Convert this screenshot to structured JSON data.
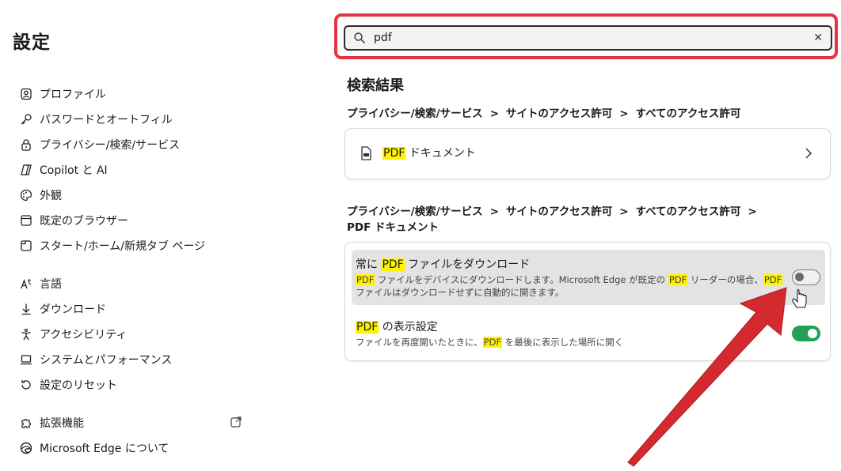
{
  "app": {
    "title": "設定"
  },
  "sidebar": {
    "items": [
      {
        "label": "プロファイル",
        "icon": "profile-icon"
      },
      {
        "label": "パスワードとオートフィル",
        "icon": "key-icon"
      },
      {
        "label": "プライバシー/検索/サービス",
        "icon": "lock-icon"
      },
      {
        "label": "Copilot と AI",
        "icon": "copilot-icon"
      },
      {
        "label": "外観",
        "icon": "palette-icon"
      },
      {
        "label": "既定のブラウザー",
        "icon": "browser-icon"
      },
      {
        "label": "スタート/ホーム/新規タブ ページ",
        "icon": "home-icon"
      },
      {
        "label": "言語",
        "icon": "language-icon"
      },
      {
        "label": "ダウンロード",
        "icon": "download-icon"
      },
      {
        "label": "アクセシビリティ",
        "icon": "accessibility-icon"
      },
      {
        "label": "システムとパフォーマンス",
        "icon": "laptop-icon"
      },
      {
        "label": "設定のリセット",
        "icon": "reset-icon"
      },
      {
        "label": "拡張機能",
        "icon": "puzzle-icon"
      },
      {
        "label": "Microsoft Edge について",
        "icon": "edge-icon"
      }
    ]
  },
  "search": {
    "value": "pdf",
    "icons": [
      "search-icon",
      "close-icon"
    ]
  },
  "results": {
    "title": "検索結果",
    "group1": {
      "breadcrumb": [
        "プライバシー/検索/サービス",
        "サイトのアクセス許可",
        "すべてのアクセス許可"
      ],
      "separator": ">",
      "item": {
        "hl": "PDF",
        "rest": " ドキュメント"
      }
    },
    "group2": {
      "breadcrumb": [
        "プライバシー/検索/サービス",
        "サイトのアクセス許可",
        "すべてのアクセス許可"
      ],
      "separator": ">",
      "breadcrumb_last": "PDF ドキュメント",
      "settings": [
        {
          "title_pre": "常に ",
          "title_hl": "PDF",
          "title_post": " ファイルをダウンロード",
          "desc1_hl1": "PDF",
          "desc1_mid": " ファイルをデバイスにダウンロードします。Microsoft Edge が既定の ",
          "desc1_hl2": "PDF",
          "desc1_post": " リーダーの場合、",
          "desc1_hl3": "PDF",
          "desc2": "ファイルはダウンロードせずに自動的に開きます。",
          "toggle": "off"
        },
        {
          "title_hl": "PDF",
          "title_post": " の表示設定",
          "desc_pre": "ファイルを再度開いたときに、",
          "desc_hl": "PDF",
          "desc_post": " を最後に表示した場所に開く",
          "toggle": "on"
        }
      ]
    }
  },
  "colors": {
    "highlight": "#fff200",
    "annotation_red": "#e2353f",
    "arrow_red": "#d42a2f",
    "toggle_on": "#22a055"
  }
}
